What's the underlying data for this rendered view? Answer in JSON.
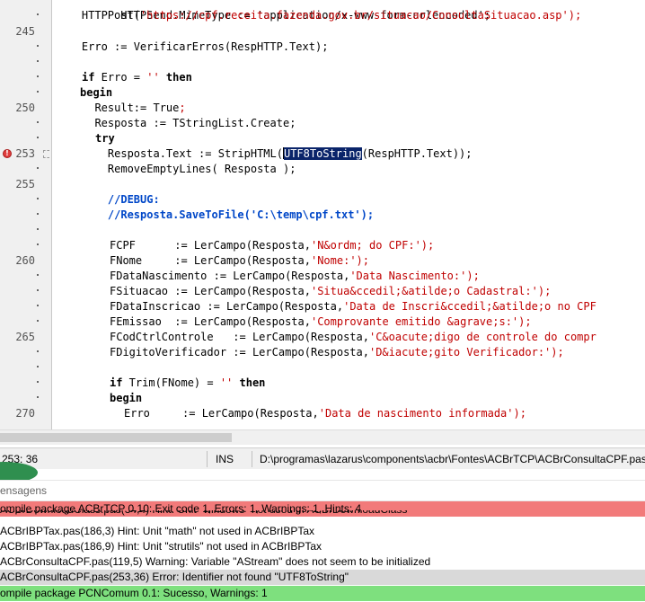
{
  "editor": {
    "gutter_numbers": {
      "l245": "245",
      "l250": "250",
      "l253": "253",
      "l255": "255",
      "l260": "260",
      "l265": "265",
      "l270": "270"
    },
    "breakpoint_icon": "error-marker-icon",
    "code": {
      "l241": "    HTTPSend.MimeType := 'application/x-www-form-urlencoded';",
      "l242a": "    HTTPPost(",
      "l242b": "'https://cpf.receita.fazenda.gov.br/situacao/ConsultaSituacao.asp'",
      "l242c": ");",
      "l244a": "    Erro := VerificarErros(RespHTTP.Text);",
      "l246a": "if",
      "l246b": " Erro = ",
      "l246c": "''",
      "l246d": " then",
      "l247": "begin",
      "l248a": "  Result:= ",
      "l248b": "True",
      "l248c": ";",
      "l249": "  Resposta := TStringList.Create;",
      "l250": "try",
      "l252a": "    Resposta.Text := StripHTML(",
      "l252sel": "UTF8ToString",
      "l252b": "(RespHTTP.Text));",
      "l253": "    RemoveEmptyLines( Resposta );",
      "l255": "    //DEBUG:",
      "l256": "    //Resposta.SaveToFile('C:\\temp\\cpf.txt');",
      "f1a": "FCPF      := LerCampo(Resposta,",
      "f1b": "'N&ordm; do CPF:'",
      "f2a": "FNome     := LerCampo(Resposta,",
      "f2b": "'Nome:'",
      "f3a": "FDataNascimento := LerCampo(Resposta,",
      "f3b": "'Data Nascimento:'",
      "f4a": "FSituacao := LerCampo(Resposta,",
      "f4b": "'Situa&ccedil;&atilde;o Cadastral:'",
      "f5a": "FDataInscricao := LerCampo(Resposta,",
      "f5b": "'Data de Inscri&ccedil;&atilde;o no CPF",
      "f6a": "FEmissao  := LerCampo(Resposta,",
      "f6b": "'Comprovante emitido &agrave;s:'",
      "f7a": "FCodCtrlControle   := LerCampo(Resposta,",
      "f7b": "'C&oacute;digo de controle do compr",
      "f8a": "FDigitoVerificador := LerCampo(Resposta,",
      "f8b": "'D&iacute;gito Verificador:'",
      "close": ");",
      "l268a": "if",
      "l268b": " Trim(FNome) = ",
      "l268c": "''",
      "l268d": " then",
      "l269": "begin",
      "l270a": "Erro     := LerCampo(Resposta,",
      "l270b": "'Data de nascimento informada'"
    }
  },
  "statusbar": {
    "position": "253: 36",
    "mode": "INS",
    "file_path": "D:\\programas\\lazarus\\components\\acbr\\Fontes\\ACBrTCP\\ACBrConsultaCPF.pas"
  },
  "messages": {
    "title": "ensagens",
    "items": [
      "ompile package ACBrTCP 0.10: Exit code 1, Errors: 1, Warnings: 1, Hints: 4",
      "ACBrDownloadClass.pas(34,4) Hint: Unit \"windows\" not used in ACBrDownloadClass",
      "ACBrIBPTax.pas(186,3) Hint: Unit \"math\" not used in ACBrIBPTax",
      "ACBrIBPTax.pas(186,9) Hint: Unit \"strutils\" not used in ACBrIBPTax",
      "ACBrConsultaCPF.pas(119,5) Warning: Variable \"AStream\" does not seem to be initialized",
      "ACBrConsultaCPF.pas(253,36) Error: Identifier not found \"UTF8ToString\"",
      "ompile package PCNComum 0.1: Sucesso, Warnings: 1"
    ],
    "colors": {
      "error": "#f27a7a",
      "success": "#7ee07e",
      "selected": "#d9d9d9"
    }
  }
}
